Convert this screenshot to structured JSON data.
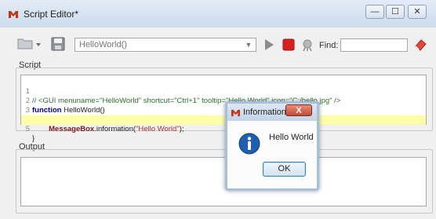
{
  "window": {
    "title": "Script Editor*",
    "controls": {
      "minimize": "—",
      "maximize": "☐",
      "close": "✕"
    }
  },
  "toolbar": {
    "function_select": {
      "value": "HelloWorld()"
    },
    "find": {
      "label": "Find:",
      "value": ""
    },
    "icons": [
      "folder-open-icon",
      "save-icon",
      "run-icon",
      "stop-icon",
      "debug-icon",
      "eraser-icon"
    ]
  },
  "script": {
    "label": "Script",
    "lines": [
      {
        "num": "1",
        "parts": [
          {
            "text": "// <GUI menuname=\"HelloWorld\" shortcut=\"Ctrl+1\" tooltip=\"Hello World\" icon=\"C:/hello.jpg\" />",
            "style": "comment"
          }
        ]
      },
      {
        "num": "2",
        "parts": [
          {
            "text": "function",
            "style": "keyword"
          },
          {
            "text": " HelloWorld()",
            "style": "plain"
          }
        ]
      },
      {
        "num": "3",
        "parts": [
          {
            "text": "{",
            "style": "plain"
          }
        ]
      },
      {
        "num": "4",
        "parts": [
          {
            "text": "        ",
            "style": "plain"
          },
          {
            "text": "MessageBox",
            "style": "object"
          },
          {
            "text": ".information(",
            "style": "plain"
          },
          {
            "text": "\"Hello World\"",
            "style": "string"
          },
          {
            "text": ");",
            "style": "plain"
          }
        ]
      },
      {
        "num": "5",
        "parts": [
          {
            "text": "}",
            "style": "plain"
          }
        ],
        "highlighted": true
      }
    ]
  },
  "output": {
    "label": "Output"
  },
  "dialog": {
    "title": "Information",
    "close_label": "X",
    "message": "Hello World",
    "ok_label": "OK"
  },
  "colors": {
    "title_bar": "#d3e0f0",
    "line_highlight": "#ffffa8",
    "stop_red": "#d71f1f",
    "info_blue": "#1f5fb0",
    "comment": "#2f6f2f",
    "keyword": "#00009a",
    "object": "#7a1b1b",
    "string": "#b13030"
  }
}
